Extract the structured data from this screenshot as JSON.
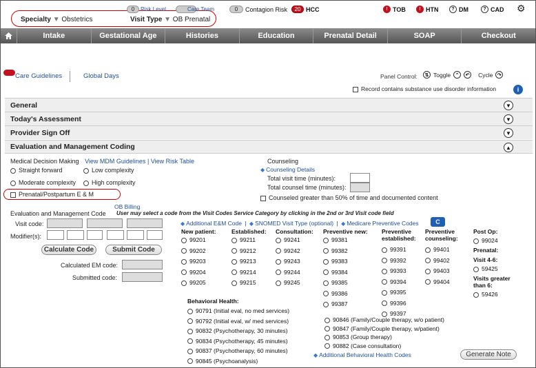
{
  "header": {
    "specialty_label": "Specialty",
    "specialty_value": "Obstetrics",
    "visit_type_label": "Visit Type",
    "visit_type_value": "OB Prenatal",
    "risk_count": "0",
    "risk_label": "Risk Level",
    "care_team_label": "Care Team",
    "contagion_count": "0",
    "contagion_label": "Contagion Risk",
    "hcc_count": "20",
    "hcc_label": "HCC",
    "tob": "TOB",
    "htn": "HTN",
    "dm": "DM",
    "cad": "CAD"
  },
  "nav": {
    "tabs": [
      "Intake",
      "Gestational Age",
      "Histories",
      "Education",
      "Prenatal Detail",
      "SOAP",
      "Checkout"
    ]
  },
  "subbar": {
    "care_guidelines": "Care Guidelines",
    "global_days": "Global Days",
    "panel_control": "Panel Control:",
    "toggle": "Toggle",
    "cycle": "Cycle",
    "substance_label": "Record contains substance use disorder information"
  },
  "sections": {
    "general": "General",
    "assessment": "Today's Assessment",
    "signoff": "Provider Sign Off",
    "em": "Evaluation and Management Coding"
  },
  "mdm": {
    "label": "Medical Decision Making",
    "mdm_link": "View MDM Guidelines",
    "sep": "|",
    "risk_link": "View Risk Table",
    "opt1": "Straight forward",
    "opt2": "Low complexity",
    "opt3": "Moderate complexity",
    "opt4": "High complexity",
    "prenatal": "Prenatal/Postpartum E & M"
  },
  "counseling": {
    "label": "Counseling",
    "details": "Counseling Details",
    "total_visit": "Total visit time (minutes):",
    "total_counsel": "Total counsel time (minutes):",
    "greater": "Counseled greater than 50% of time and documented content"
  },
  "emc": {
    "label": "Evaluation and Management Code",
    "ob_billing": "OB Billing",
    "instruction": "User may select a code from the Visit Codes Service Category by clicking in the 2nd or 3rd Visit code field",
    "visit_code": "Visit code:",
    "modifiers": "Modifier(s):",
    "calc_btn": "Calculate Code",
    "submit_btn": "Submit Code",
    "calc_em": "Calculated EM code:",
    "submitted": "Submitted code:",
    "additional": "Additional E&M Code",
    "snomed": "SNOMED Visit Type (optional)",
    "medicare": "Medicare Preventive Codes",
    "sep": "|"
  },
  "cols": [
    {
      "h1": "New patient:",
      "h2": "",
      "codes": [
        "99201",
        "99202",
        "99203",
        "99204",
        "99205"
      ]
    },
    {
      "h1": "Established:",
      "h2": "",
      "codes": [
        "99211",
        "99212",
        "99213",
        "99214",
        "99215"
      ]
    },
    {
      "h1": "Consultation:",
      "h2": "",
      "codes": [
        "99241",
        "99242",
        "99243",
        "99244",
        "99245"
      ]
    },
    {
      "h1": "Preventive new:",
      "h2": "",
      "codes": [
        "99381",
        "99382",
        "99383",
        "99384",
        "99385",
        "99386",
        "99387"
      ]
    },
    {
      "h1": "Preventive",
      "h2": "established:",
      "codes": [
        "99391",
        "99392",
        "99393",
        "99394",
        "99395",
        "99396",
        "99397"
      ]
    },
    {
      "h1": "Preventive",
      "h2": "counseling:",
      "codes": [
        "99401",
        "99402",
        "99403",
        "99404"
      ]
    }
  ],
  "postop": {
    "h": "Post Op:",
    "code": "99024",
    "prenatal": "Prenatal:",
    "visit46": "Visit 4-6:",
    "code46": "59425",
    "greater6a": "Visits greater",
    "greater6b": "than 6:",
    "code6": "59426"
  },
  "behavioral": {
    "label": "Behavioral Health:",
    "left": [
      "90791 (Initial eval, no med services)",
      "90792 (Initial eval, w/ med services)",
      "90832 (Psychotherapy, 30 minutes)",
      "90834 (Psychotherapy, 45 minutes)",
      "90837 (Psychotherapy, 60 minutes)",
      "90845 (Psychoanalysis)"
    ],
    "right": [
      "90846 (Family/Couple therapy, w/o patient)",
      "90847 (Family/Couple therapy, w/patient)",
      "90853 (Group therapy)",
      "90882 (Case consultation)"
    ],
    "additional": "Additional Behavioral Health Codes",
    "generate": "Generate Note"
  }
}
